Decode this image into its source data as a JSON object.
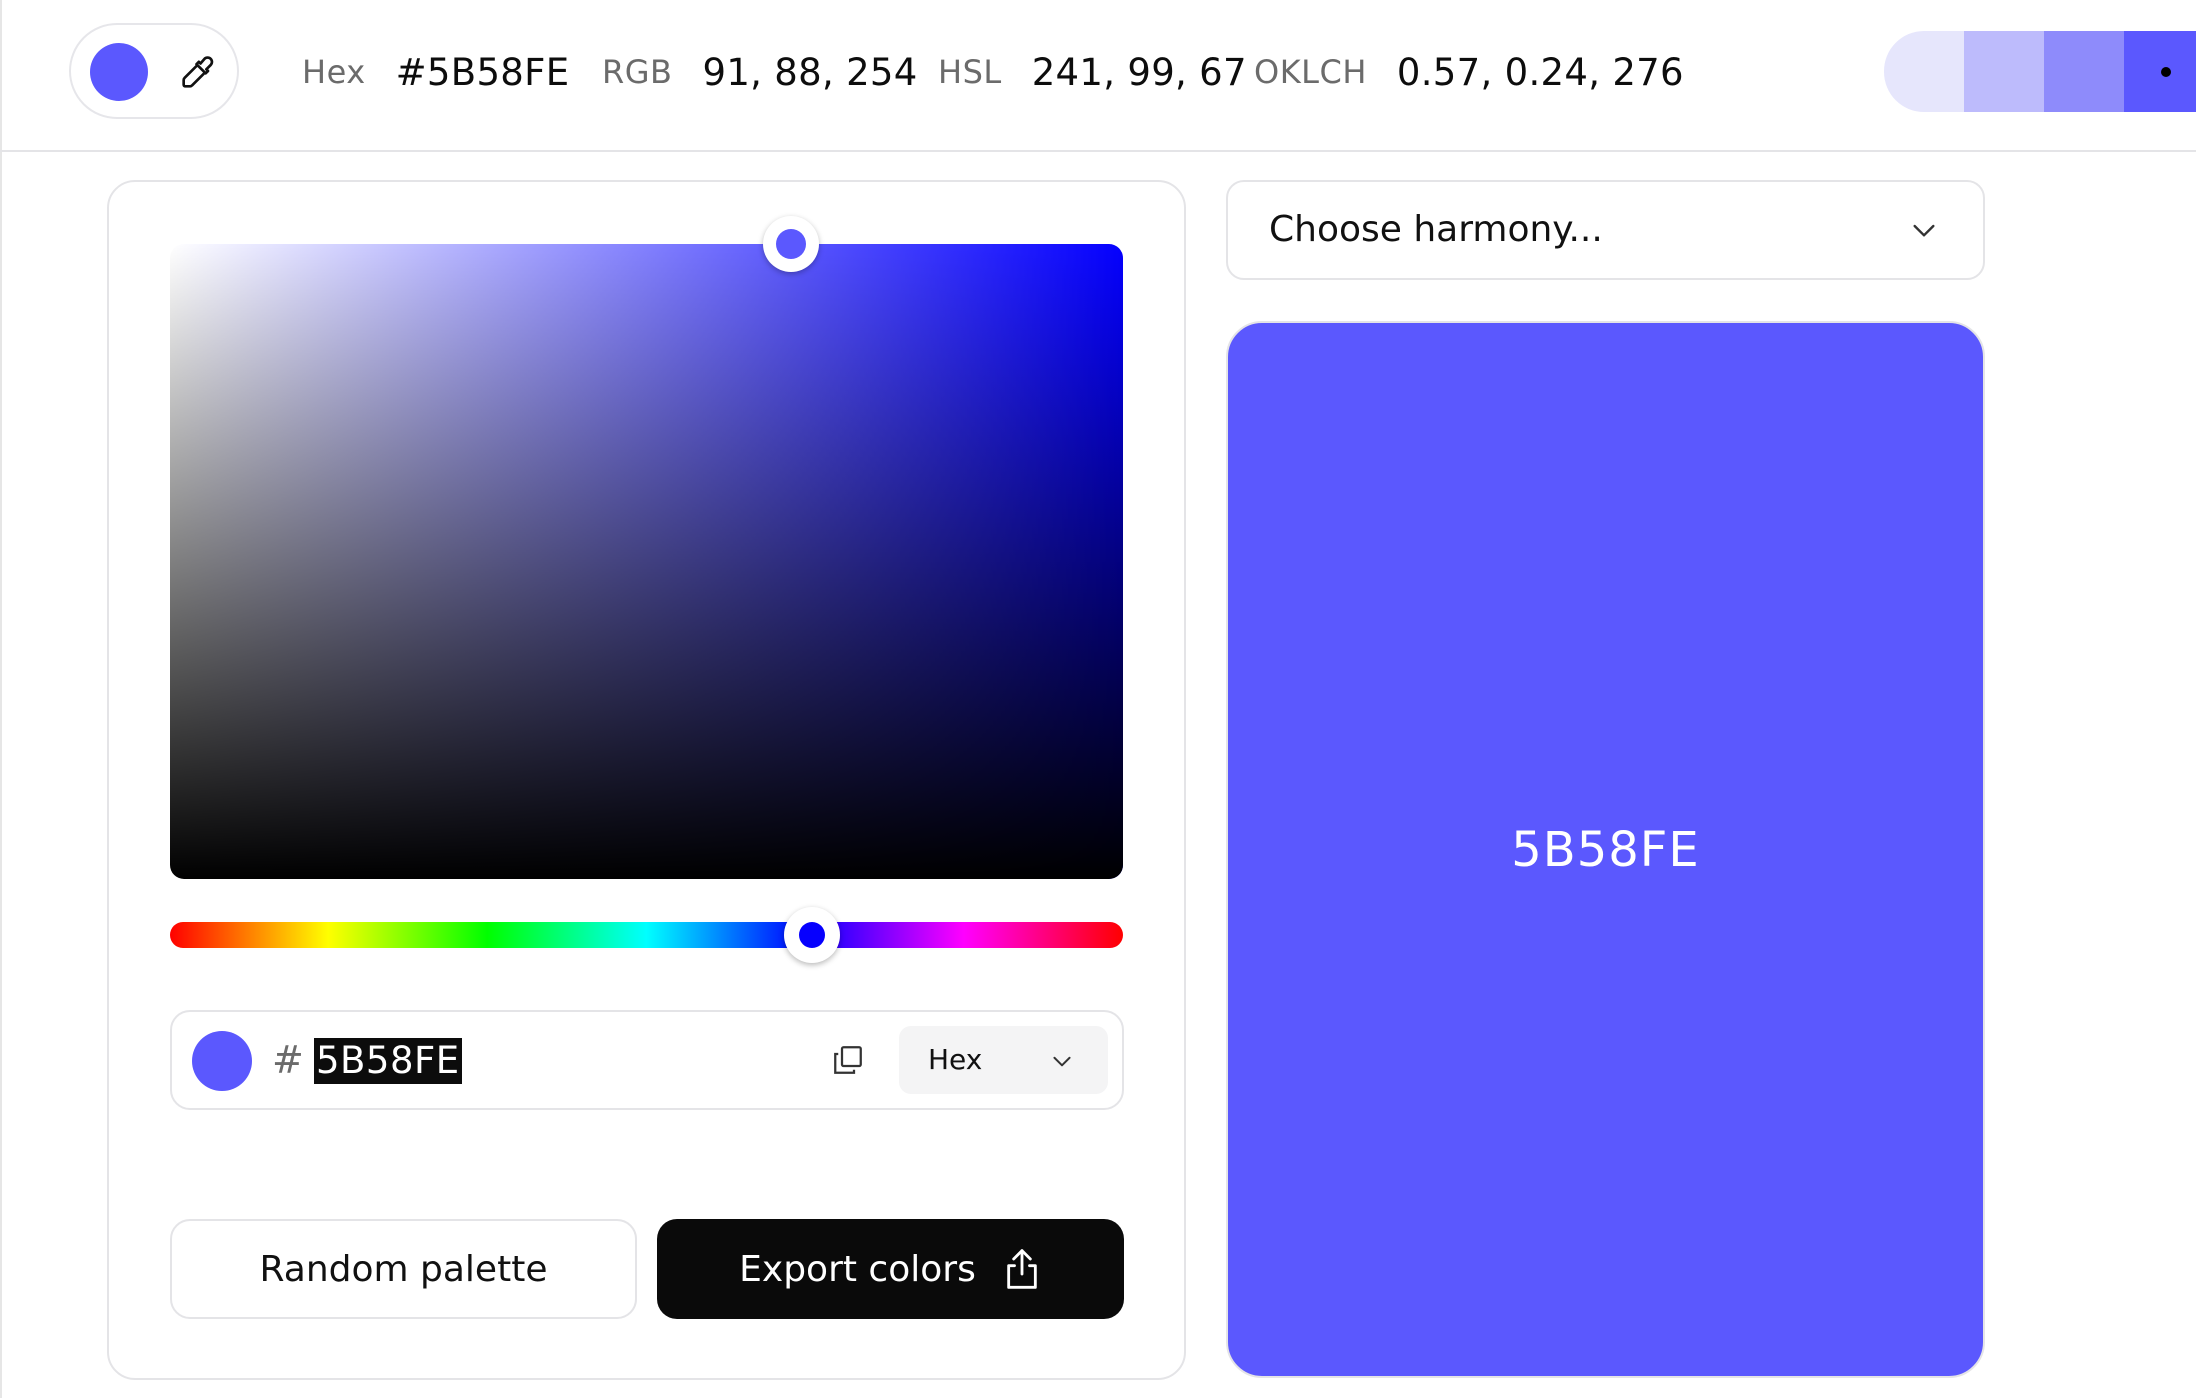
{
  "current_color": "#5B58FE",
  "hue_slider_color": "#0600FE",
  "toolbar": {
    "hex_label": "Hex",
    "hex_value": "#5B58FE",
    "rgb_label": "RGB",
    "rgb_value": "91, 88, 254",
    "hsl_label": "HSL",
    "hsl_value": "241, 99, 67",
    "oklch_label": "OKLCH",
    "oklch_value": "0.57, 0.24, 276",
    "shades": [
      "#E6E6FC",
      "#BDBBFC",
      "#8E8BFB",
      "#5B58FE"
    ]
  },
  "picker": {
    "hue": 241,
    "saturation": 0.65,
    "brightness": 1.0,
    "hash_symbol": "#",
    "hex_input": "5B58FE",
    "format_label": "Hex",
    "random_button": "Random palette",
    "export_button": "Export colors"
  },
  "harmony": {
    "placeholder": "Choose harmony..."
  },
  "preview": {
    "code": "5B58FE"
  }
}
